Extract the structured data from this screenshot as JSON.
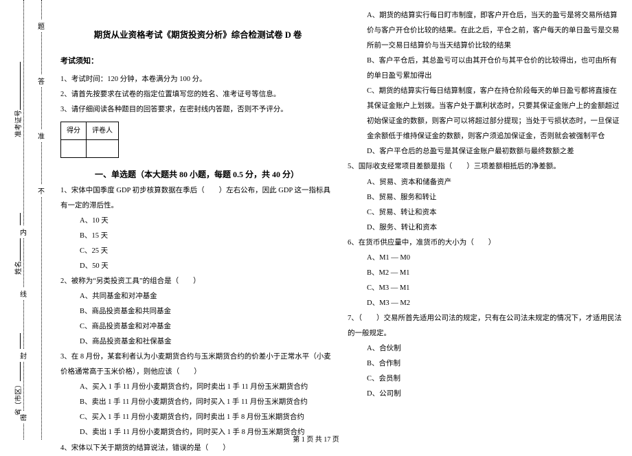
{
  "binding": {
    "vert_labels": [
      "省（市区）",
      "姓名",
      "准考证号"
    ],
    "chars": [
      "密",
      "封",
      "线",
      "内",
      "不",
      "准",
      "答",
      "题"
    ]
  },
  "title": "期货从业资格考试《期货投资分析》综合检测试卷 D 卷",
  "notice": {
    "head": "考试须知：",
    "items": [
      "1、考试时间：120 分钟，本卷满分为 100 分。",
      "2、请首先按要求在试卷的指定位置填写您的姓名、准考证号等信息。",
      "3、请仔细阅读各种题目的回答要求，在密封线内答题，否则不予评分。"
    ]
  },
  "score": {
    "c1": "得分",
    "c2": "评卷人"
  },
  "section1": "一、单选题（本大题共 80 小题，每题 0.5 分，共 40 分）",
  "left": {
    "q1": "1、宋体中国季度 GDP 初步核算数据在季后（　　）左右公布，因此 GDP 这一指标具有一定的滞后性。",
    "q1a": "A、10 天",
    "q1b": "B、15 天",
    "q1c": "C、25 天",
    "q1d": "D、50 天",
    "q2": "2、被称为“另类投资工具”的组合是（　　）",
    "q2a": "A、共同基金和对冲基金",
    "q2b": "B、商品投资基金和共同基金",
    "q2c": "C、商品投资基金和对冲基金",
    "q2d": "D、商品投资基金和社保基金",
    "q3": "3、在 8 月份，某套利者认为小麦期货合约与玉米期货合约的价差小于正常水平（小麦价格通常高于玉米价格），则他应该（　　）",
    "q3a": "A、买入 1 手 11 月份小麦期货合约，同时卖出 1 手 11 月份玉米期货合约",
    "q3b": "B、卖出 1 手 11 月份小麦期货合约，同时买入 1 手 11 月份玉米期货合约",
    "q3c": "C、买入 1 手 11 月份小麦期货合约，同时卖出 1 手 8 月份玉米期货合约",
    "q3d": "D、卖出 1 手 11 月份小麦期货合约，同时买入 1 手 8 月份玉米期货合约",
    "q4": "4、宋体以下关于期货的结算说法，错误的是（　　）"
  },
  "right": {
    "p1": "A、期货的结算实行每日盯市制度，即客户开仓后，当天的盈亏是将交易所结算价与客户开仓价比较的结果。在此之后，平仓之前，客户每天的单日盈亏是交易所前一交易日结算价与当天结算价比较的结果",
    "p2": "B、客户平仓后，其总盈亏可以由其开仓价与其平仓价的比较得出，也可由所有的单日盈亏累加得出",
    "p3": "C、期货的结算实行每日结算制度，客户在持仓阶段每天的单日盈亏都将直接在其保证金账户上划拨。当客户处于赢利状态时，只要其保证金账户上的金额超过初始保证金的数额，则客户可以将超过部分提现；当处于亏损状态时，一旦保证金余额低于维持保证金的数额，则客户须追加保证金，否则就会被强制平仓",
    "p4": "D、客户平仓后的总盈亏是其保证金账户最初数额与最终数额之差",
    "q5": "5、国际收支经常项目差额是指（　　）三项差额相抵后的净差额。",
    "q5a": "A、贸易、资本和储备资产",
    "q5b": "B、贸易、服务和转让",
    "q5c": "C、贸易、转让和资本",
    "q5d": "D、服务、转让和资本",
    "q6": "6、在货币供应量中，准货币的大小为（　　）",
    "q6a": "A、M1 — M0",
    "q6b": "B、M2 — M1",
    "q6c": "C、M3 — M1",
    "q6d": "D、M3 — M2",
    "q7": "7、（　　）交易所首先适用公司法的规定，只有在公司法未规定的情况下，才适用民法的一般规定。",
    "q7a": "A、合伙制",
    "q7b": "B、合作制",
    "q7c": "C、会员制",
    "q7d": "D、公司制"
  },
  "footer": "第 1 页 共 17 页"
}
